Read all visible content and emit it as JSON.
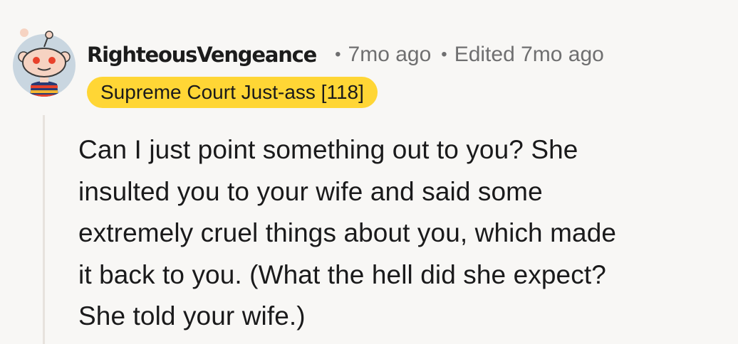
{
  "comment": {
    "author": "RighteousVengeance",
    "separator": "•",
    "posted_time": "7mo ago",
    "edited_text": "Edited 7mo ago",
    "flair": "Supreme Court Just-ass [118]",
    "body": "Can I just point something out to you? She\ninsulted you to your wife and said some\nextremely cruel things about you, which made\nit back to you. (What the hell did she expect?\nShe told your wife.)"
  },
  "colors": {
    "background": "#f8f7f5",
    "flair_background": "#ffd635",
    "meta_text": "#6f6f70",
    "thread_line": "#e7e2dd",
    "avatar_background": "#c9d6e0"
  },
  "icons": {
    "avatar": "snoo-avatar-icon"
  }
}
